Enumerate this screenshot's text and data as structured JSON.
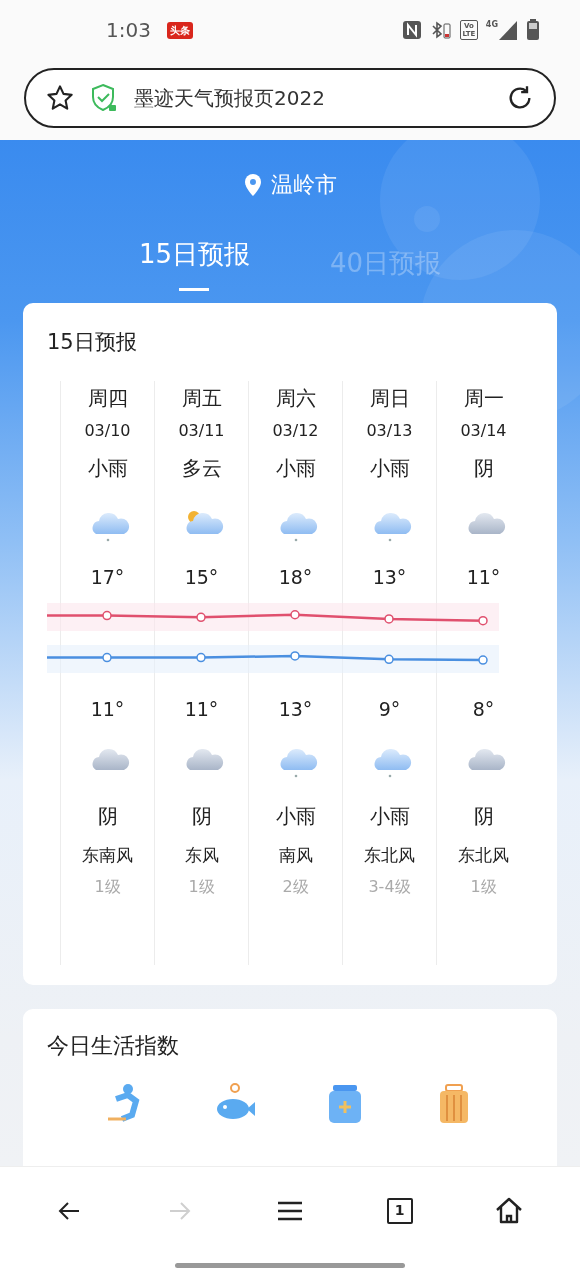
{
  "status_bar": {
    "time": "1:03",
    "badge": "头条",
    "volte": "Vo LTE",
    "network": "4G"
  },
  "address_bar": {
    "title": "墨迹天气预报页2022"
  },
  "location": "温岭市",
  "tabs": [
    {
      "label": "15日预报",
      "selected": true
    },
    {
      "label": "40日预报",
      "selected": false
    }
  ],
  "forecast": {
    "title": "15日预报",
    "days": [
      {
        "day": "周四",
        "date": "03/10",
        "day_condition": "小雨",
        "day_icon": {
          "kind": "rain"
        },
        "high": "17°",
        "low": "11°",
        "night_icon": {
          "kind": "overcast"
        },
        "night_condition": "阴",
        "wind": "东南风",
        "wind_level": "1级"
      },
      {
        "day": "周五",
        "date": "03/11",
        "day_condition": "多云",
        "day_icon": {
          "kind": "partly"
        },
        "high": "15°",
        "low": "11°",
        "night_icon": {
          "kind": "overcast"
        },
        "night_condition": "阴",
        "wind": "东风",
        "wind_level": "1级"
      },
      {
        "day": "周六",
        "date": "03/12",
        "day_condition": "小雨",
        "day_icon": {
          "kind": "rain"
        },
        "high": "18°",
        "low": "13°",
        "night_icon": {
          "kind": "rain"
        },
        "night_condition": "小雨",
        "wind": "南风",
        "wind_level": "2级"
      },
      {
        "day": "周日",
        "date": "03/13",
        "day_condition": "小雨",
        "day_icon": {
          "kind": "rain"
        },
        "high": "13°",
        "low": "9°",
        "night_icon": {
          "kind": "rain"
        },
        "night_condition": "小雨",
        "wind": "东北风",
        "wind_level": "3-4级"
      },
      {
        "day": "周一",
        "date": "03/14",
        "day_condition": "阴",
        "day_icon": {
          "kind": "overcast"
        },
        "high": "11°",
        "low": "8°",
        "night_icon": {
          "kind": "overcast"
        },
        "night_condition": "阴",
        "wind": "东北风",
        "wind_level": "1级"
      }
    ]
  },
  "life_index": {
    "title": "今日生活指数",
    "items": [
      {
        "kind": "sport"
      },
      {
        "kind": "fishing"
      },
      {
        "kind": "medicine"
      },
      {
        "kind": "luggage"
      }
    ]
  },
  "bottom_nav": [
    {
      "kind": "back",
      "disabled": false
    },
    {
      "kind": "forward",
      "disabled": true
    },
    {
      "kind": "menu",
      "disabled": false
    },
    {
      "kind": "tabs",
      "label": "1",
      "disabled": false
    },
    {
      "kind": "home",
      "disabled": false
    }
  ]
}
